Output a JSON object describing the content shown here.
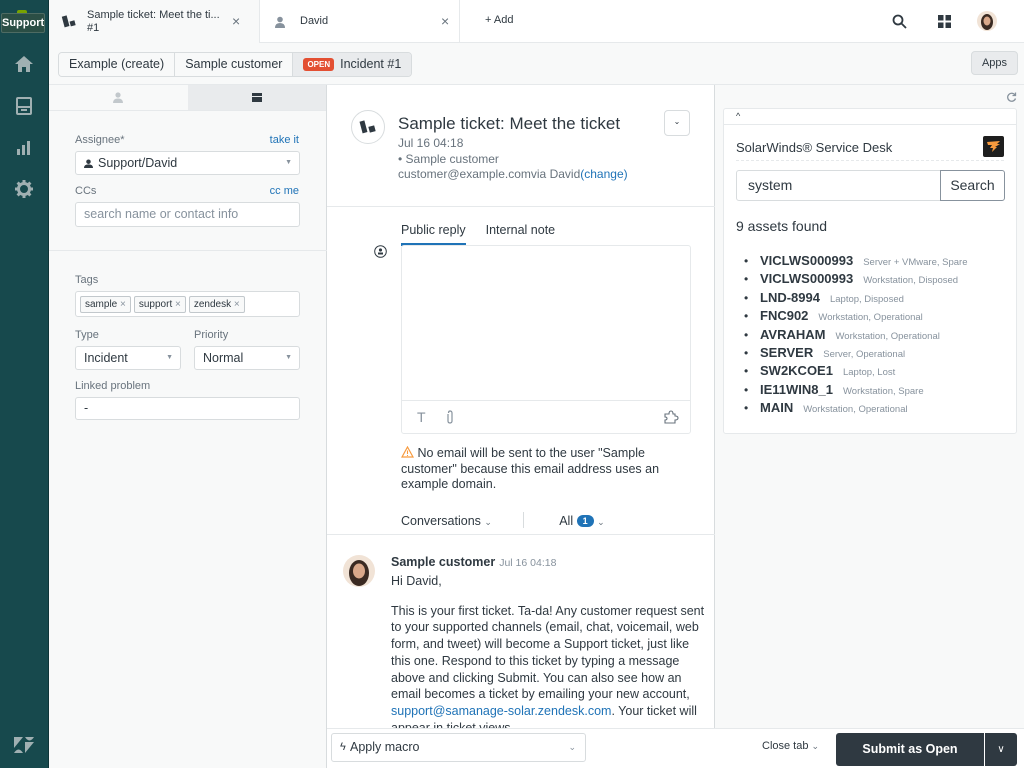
{
  "nav": {
    "brand_label": "Support",
    "items": [
      {
        "name": "home",
        "icon": "home-icon"
      },
      {
        "name": "views",
        "icon": "inbox-icon"
      },
      {
        "name": "reporting",
        "icon": "bar-chart-icon"
      },
      {
        "name": "admin",
        "icon": "gear-icon"
      }
    ],
    "logo": "zendesk-logo-icon"
  },
  "tabs": [
    {
      "title": "Sample ticket: Meet the ti...",
      "subtitle": "#1",
      "icon": "ticket-icon",
      "active": true
    },
    {
      "title": "David",
      "icon": "user-icon",
      "active": false
    }
  ],
  "add_tab_label": "+ Add",
  "breadcrumbs": [
    {
      "label": "Example (create)"
    },
    {
      "label": "Sample customer"
    },
    {
      "label": "Incident #1",
      "badge": "OPEN"
    }
  ],
  "apps_label": "Apps",
  "left_panel": {
    "assignee_label": "Assignee*",
    "take_it": "take it",
    "assignee_value": "Support/David",
    "ccs_label": "CCs",
    "cc_me": "cc me",
    "ccs_placeholder": "search name or contact info",
    "tags_label": "Tags",
    "tags": [
      "sample",
      "support",
      "zendesk"
    ],
    "type_label": "Type",
    "type_value": "Incident",
    "priority_label": "Priority",
    "priority_value": "Normal",
    "linked_label": "Linked problem",
    "linked_value": "-"
  },
  "ticket": {
    "title": "Sample ticket: Meet the ticket",
    "date": "Jul 16 04:18",
    "requester": "• Sample customer",
    "via": "customer@example.comvia David",
    "change": "(change)",
    "reply_tabs": [
      "Public reply",
      "Internal note"
    ],
    "warning": "No email will be sent to the user \"Sample customer\" because this email address uses an example domain.",
    "conversations_label": "Conversations",
    "all_label": "All",
    "all_count": "1"
  },
  "message": {
    "author": "Sample customer",
    "time": "Jul 16 04:18",
    "greeting": "Hi David,",
    "body": "This is your first ticket. Ta-da! Any customer request sent to your supported channels (email, chat, voicemail, web form, and tweet) will become a Support ticket, just like this one. Respond to this ticket by typing a message above and clicking Submit. You can also see how an email becomes a ticket by emailing your new account, ",
    "link": "support@samanage-solar.zendesk.com",
    "after_link": ". Your ticket will appear in ticket views."
  },
  "app": {
    "title": "SolarWinds® Service Desk",
    "search_value": "system",
    "search_button": "Search",
    "found": "9 assets found",
    "assets": [
      {
        "name": "VICLWS000993",
        "desc": "Server + VMware, Spare"
      },
      {
        "name": "VICLWS000993",
        "desc": "Workstation, Disposed"
      },
      {
        "name": "LND-8994",
        "desc": "Laptop, Disposed"
      },
      {
        "name": "FNC902",
        "desc": "Workstation, Operational"
      },
      {
        "name": "AVRAHAM",
        "desc": "Workstation, Operational"
      },
      {
        "name": "SERVER",
        "desc": "Server, Operational"
      },
      {
        "name": "SW2KCOE1",
        "desc": "Laptop, Lost"
      },
      {
        "name": "IE11WIN8_1",
        "desc": "Workstation, Spare"
      },
      {
        "name": "MAIN",
        "desc": "Workstation, Operational"
      }
    ]
  },
  "footer": {
    "macro_label": "Apply macro",
    "close_tab": "Close tab",
    "submit_prefix": "Submit as ",
    "submit_status": "Open"
  },
  "colors": {
    "nav_bg": "#17494d",
    "accent": "#1f73b7",
    "open_badge": "#e34f32",
    "submit_bg": "#2f3941",
    "warning": "#f79a3e"
  }
}
